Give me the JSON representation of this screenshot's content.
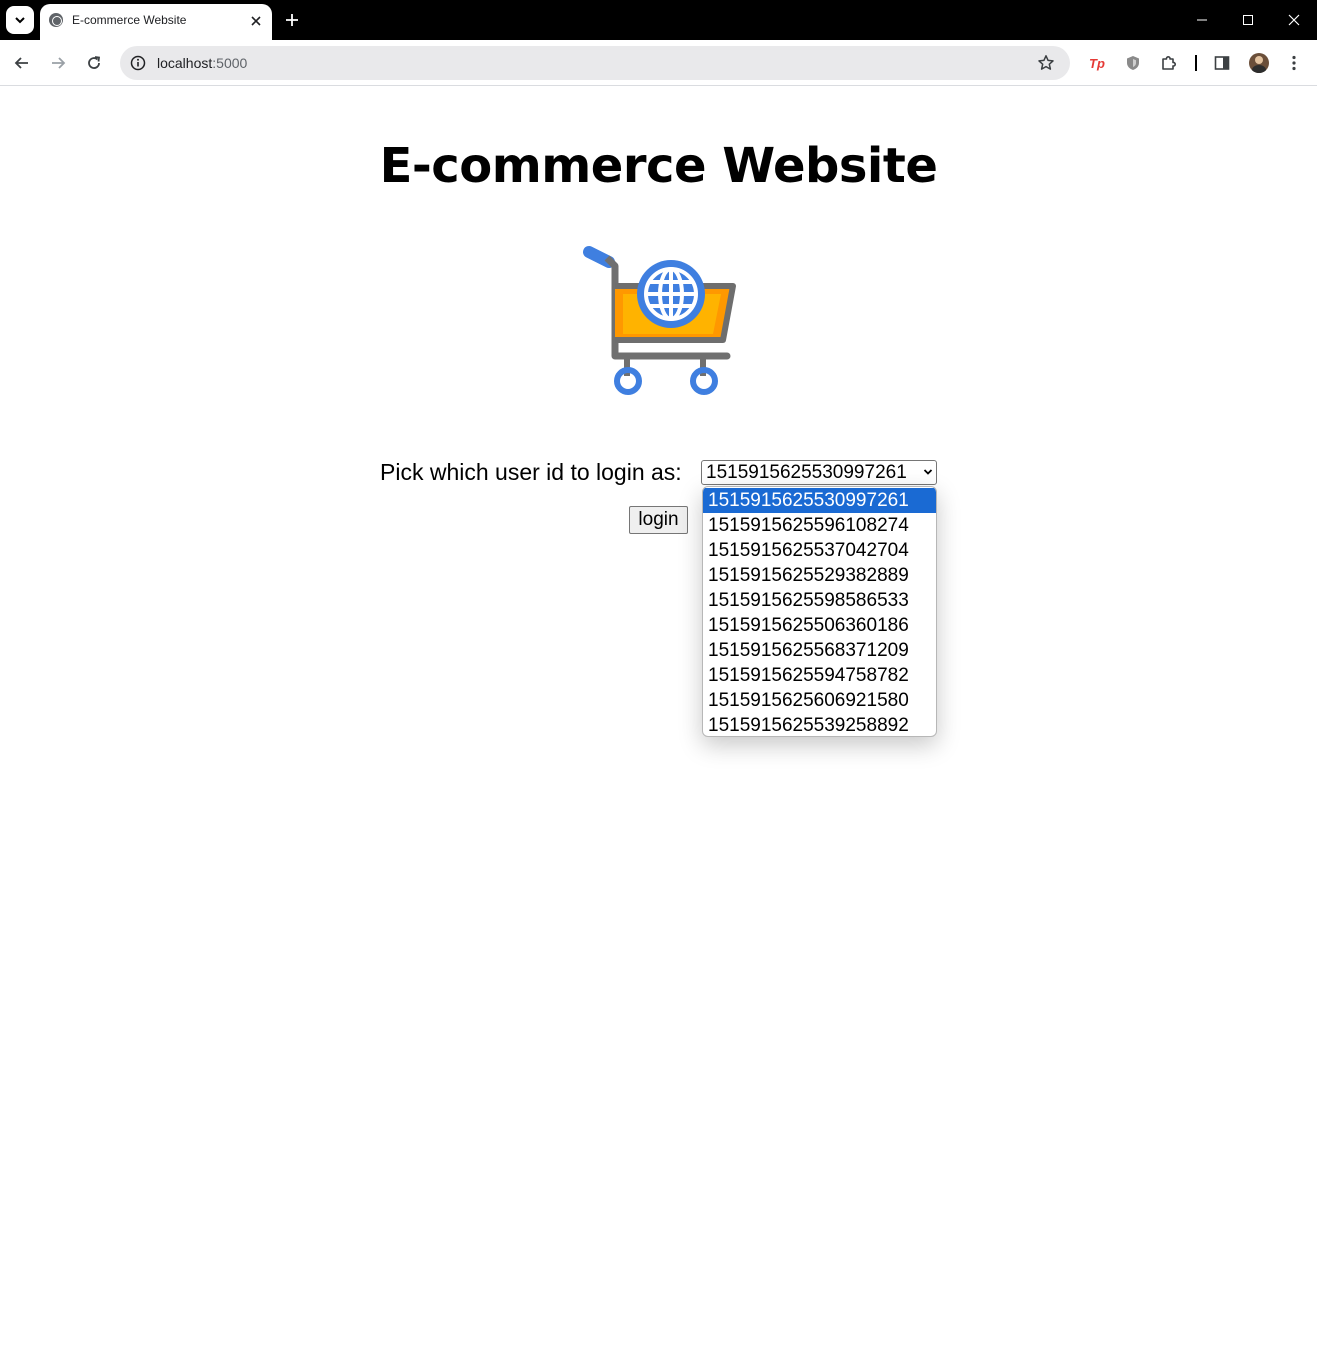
{
  "browser": {
    "tab_title": "E-commerce Website",
    "url_host": "localhost",
    "url_port": ":5000",
    "extensions": [
      "tp-extension",
      "shield-extension",
      "puzzle-extension"
    ]
  },
  "page": {
    "title": "E-commerce Website",
    "image_icon": "shopping-cart-globe",
    "pick_label": "Pick which user id to login as:",
    "selected_user_id": "1515915625530997261",
    "login_label": "login"
  },
  "dropdown": {
    "options": [
      "1515915625530997261",
      "1515915625596108274",
      "1515915625537042704",
      "1515915625529382889",
      "1515915625598586533",
      "1515915625506360186",
      "1515915625568371209",
      "1515915625594758782",
      "1515915625606921580",
      "1515915625539258892"
    ],
    "highlighted_index": 0
  },
  "colors": {
    "highlight": "#1a6ad3",
    "tab_strip": "#000000",
    "omnibox": "#e9e9eb"
  }
}
